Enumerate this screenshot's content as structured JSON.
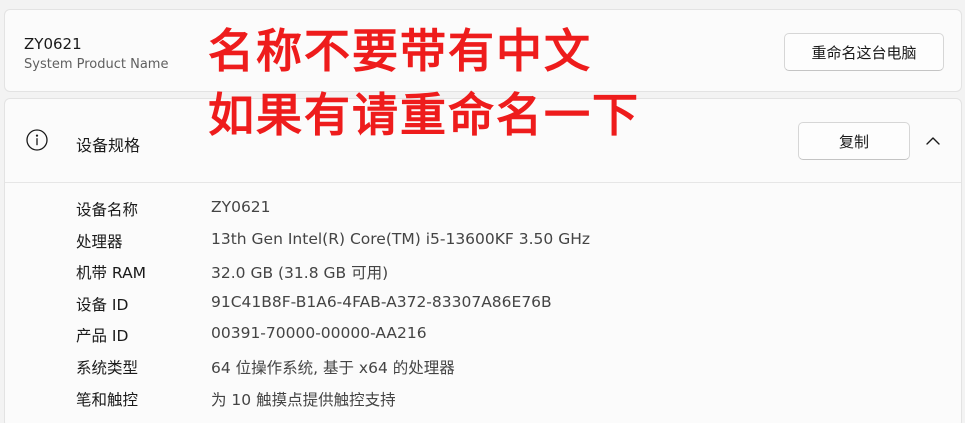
{
  "device": {
    "name": "ZY0621",
    "subtitle": "System Product Name",
    "rename_label": "重命名这台电脑"
  },
  "specs": {
    "title": "设备规格",
    "copy_label": "复制",
    "rows": [
      {
        "label": "设备名称",
        "value": "ZY0621"
      },
      {
        "label": "处理器",
        "value": "13th Gen Intel(R) Core(TM) i5-13600KF   3.50 GHz"
      },
      {
        "label": "机带 RAM",
        "value": "32.0 GB (31.8 GB 可用)"
      },
      {
        "label": "设备 ID",
        "value": "91C41B8F-B1A6-4FAB-A372-83307A86E76B"
      },
      {
        "label": "产品 ID",
        "value": "00391-70000-00000-AA216"
      },
      {
        "label": "系统类型",
        "value": "64 位操作系统, 基于 x64 的处理器"
      },
      {
        "label": "笔和触控",
        "value": "为 10 触摸点提供触控支持"
      }
    ]
  },
  "annotation": {
    "line1": "名称不要带有中文",
    "line2": "如果有请重命名一下",
    "color": "#ee1c1c"
  },
  "icons": {
    "info": "info-icon",
    "chevron": "chevron-up-icon"
  }
}
